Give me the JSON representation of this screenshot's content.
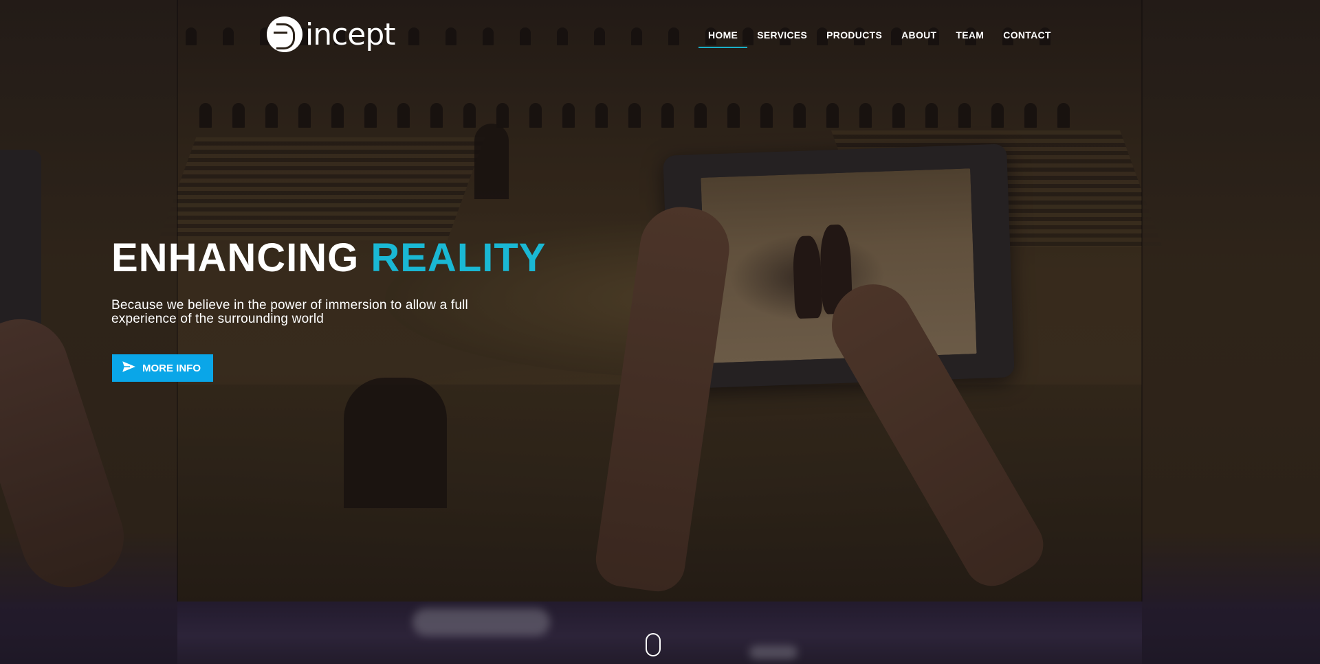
{
  "brand": {
    "name": "incept",
    "logo_icon": "circuit-brain-icon"
  },
  "nav": {
    "items": [
      {
        "label": "HOME",
        "active": true
      },
      {
        "label": "SERVICES",
        "active": false
      },
      {
        "label": "PRODUCTS",
        "active": false
      },
      {
        "label": "ABOUT",
        "active": false
      },
      {
        "label": "TEAM",
        "active": false
      },
      {
        "label": "CONTACT",
        "active": false
      }
    ],
    "active_underline_color": "#1ab0c8"
  },
  "hero": {
    "title_main": "ENHANCING",
    "title_accent": "REALITY",
    "subtitle": "Because we believe in the power of immersion to allow a full experience of the surrounding world",
    "cta_label": "MORE INFO",
    "cta_icon": "paper-plane-icon",
    "accent_color": "#1ab8d4",
    "cta_color": "#0aa6e8"
  },
  "scroll_indicator": {
    "icon": "mouse-scroll-icon"
  }
}
